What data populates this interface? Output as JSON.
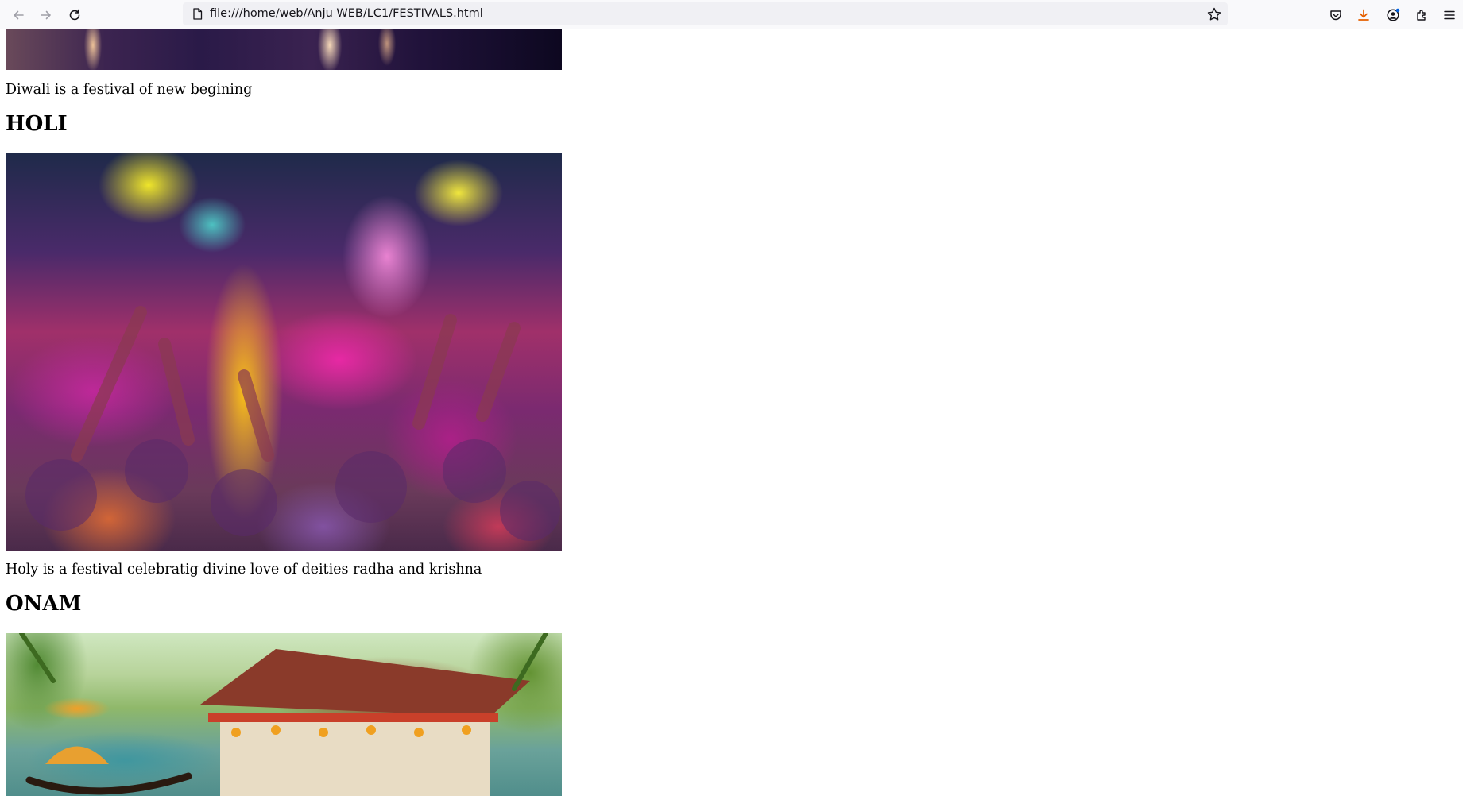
{
  "browser": {
    "url": "file:///home/web/Anju WEB/LC1/FESTIVALS.html",
    "nav": {
      "back_icon": "arrow-left-icon",
      "forward_icon": "arrow-right-icon",
      "reload_icon": "reload-icon"
    },
    "toolbar_icons": [
      "pocket-icon",
      "download-icon",
      "account-icon",
      "extensions-icon",
      "menu-icon"
    ],
    "accent_color": "#e66000"
  },
  "page": {
    "diwali": {
      "caption": "Diwali is a festival of new begining"
    },
    "holi": {
      "heading": "HOLI",
      "caption": "Holy is a festival celebratig divine love of deities radha and krishna"
    },
    "onam": {
      "heading": "ONAM"
    }
  }
}
